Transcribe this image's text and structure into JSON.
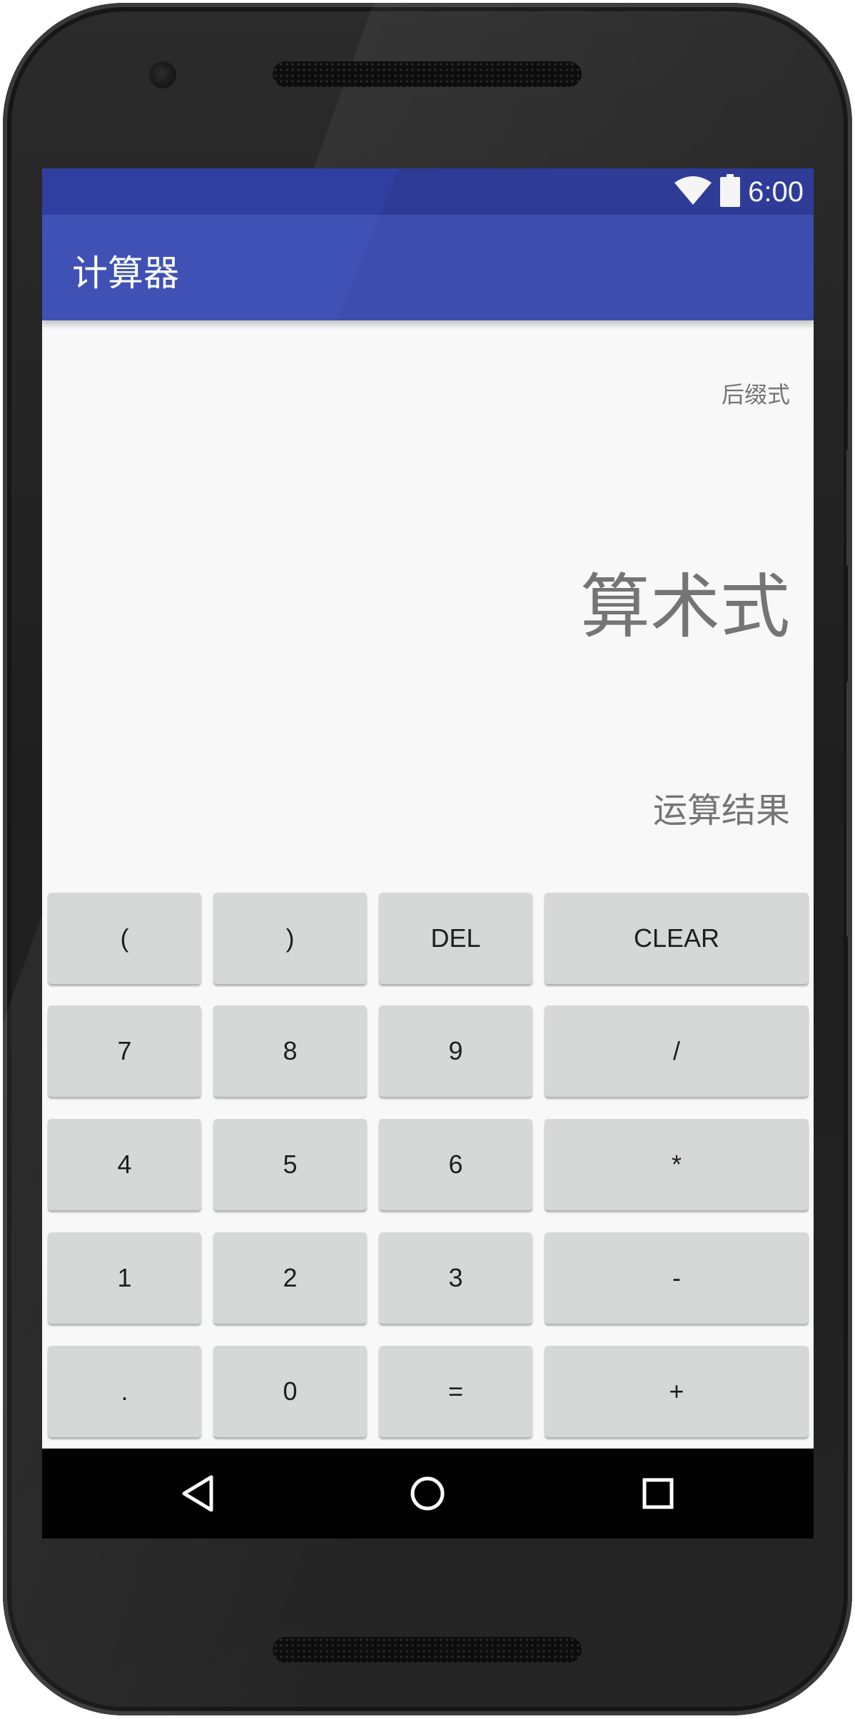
{
  "status_bar": {
    "time": "6:00",
    "icons": [
      "wifi-icon",
      "battery-icon"
    ]
  },
  "app_bar": {
    "title": "计算器"
  },
  "display": {
    "postfix_label": "后缀式",
    "expression_label": "算术式",
    "result_label": "运算结果"
  },
  "keypad": {
    "rows": [
      [
        {
          "label": "(",
          "name": "key-open-paren"
        },
        {
          "label": ")",
          "name": "key-close-paren"
        },
        {
          "label": "DEL",
          "name": "key-del"
        },
        {
          "label": "CLEAR",
          "name": "key-clear"
        }
      ],
      [
        {
          "label": "7",
          "name": "key-7"
        },
        {
          "label": "8",
          "name": "key-8"
        },
        {
          "label": "9",
          "name": "key-9"
        },
        {
          "label": "/",
          "name": "key-divide"
        }
      ],
      [
        {
          "label": "4",
          "name": "key-4"
        },
        {
          "label": "5",
          "name": "key-5"
        },
        {
          "label": "6",
          "name": "key-6"
        },
        {
          "label": "*",
          "name": "key-multiply"
        }
      ],
      [
        {
          "label": "1",
          "name": "key-1"
        },
        {
          "label": "2",
          "name": "key-2"
        },
        {
          "label": "3",
          "name": "key-3"
        },
        {
          "label": "-",
          "name": "key-minus"
        }
      ],
      [
        {
          "label": ".",
          "name": "key-decimal"
        },
        {
          "label": "0",
          "name": "key-0"
        },
        {
          "label": "=",
          "name": "key-equals"
        },
        {
          "label": "+",
          "name": "key-plus"
        }
      ]
    ]
  },
  "nav_bar": {
    "buttons": [
      "back-icon",
      "home-icon",
      "recents-icon"
    ]
  },
  "colors": {
    "status_bar": "#303f9f",
    "app_bar": "#3f51b5",
    "background": "#f8f8f8",
    "key": "#d6d7d7",
    "display_text": "#757575"
  }
}
